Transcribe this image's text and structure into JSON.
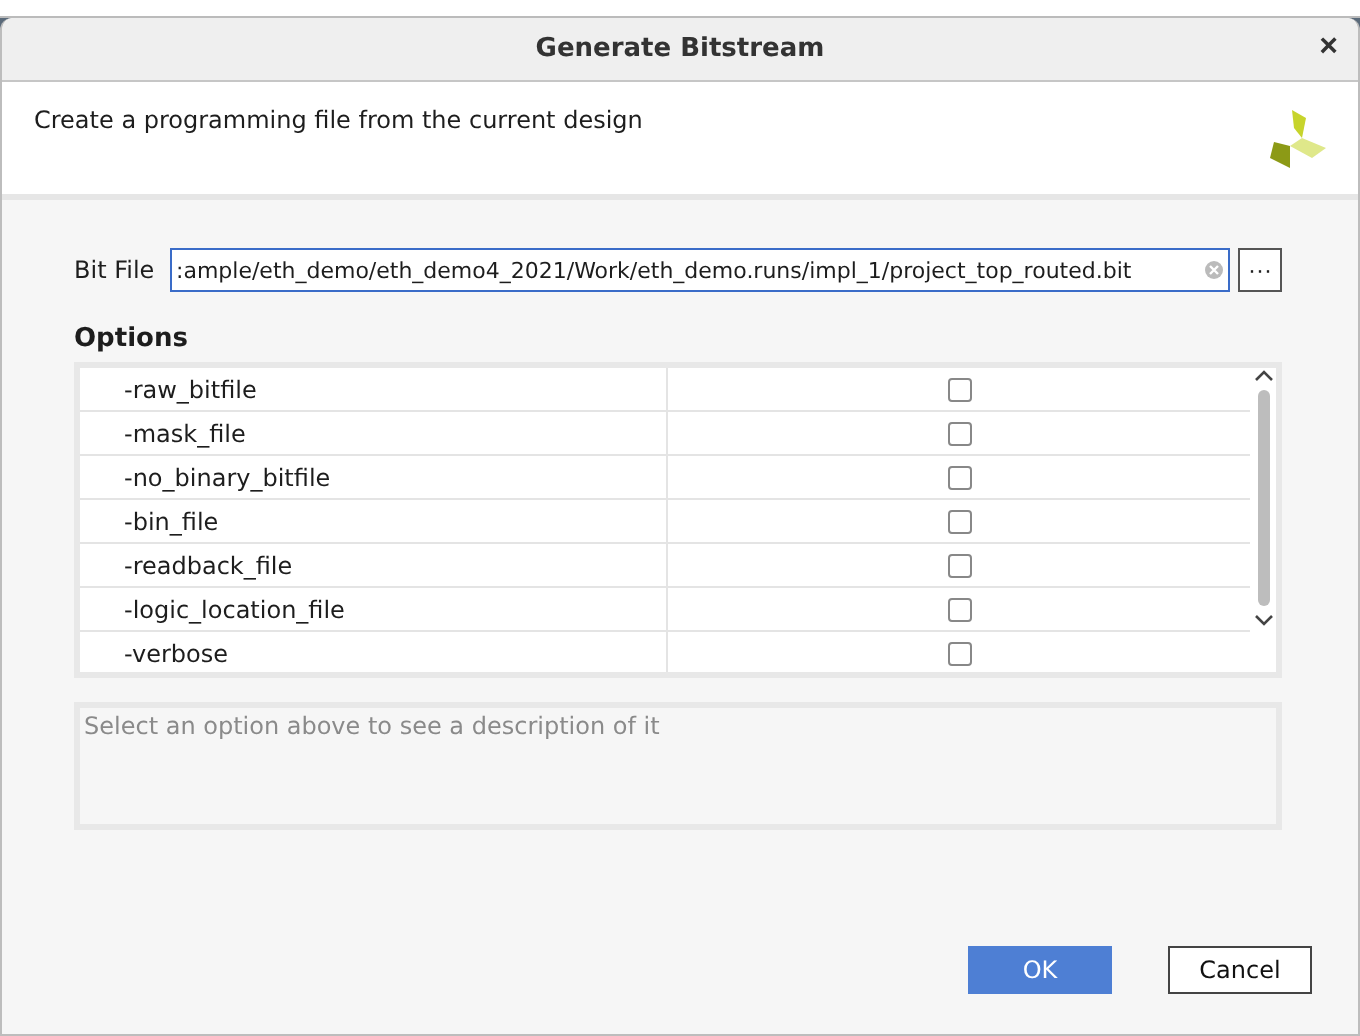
{
  "window": {
    "title": "Generate Bitstream",
    "close": "×"
  },
  "header": {
    "description": "Create a programming file from the current design"
  },
  "bit_file": {
    "label": "Bit File",
    "value": ":ample/eth_demo/eth_demo4_2021/Work/eth_demo.runs/impl_1/project_top_routed.bit",
    "browse": "···"
  },
  "options": {
    "title": "Options",
    "rows": [
      {
        "name": "-raw_bitfile",
        "checked": false
      },
      {
        "name": "-mask_file",
        "checked": false
      },
      {
        "name": "-no_binary_bitfile",
        "checked": false
      },
      {
        "name": "-bin_file",
        "checked": false
      },
      {
        "name": "-readback_file",
        "checked": false
      },
      {
        "name": "-logic_location_file",
        "checked": false
      },
      {
        "name": "-verbose",
        "checked": false
      }
    ]
  },
  "description_box": {
    "placeholder": "Select an option above to see a description of it"
  },
  "buttons": [
    "OK",
    "Cancel"
  ]
}
